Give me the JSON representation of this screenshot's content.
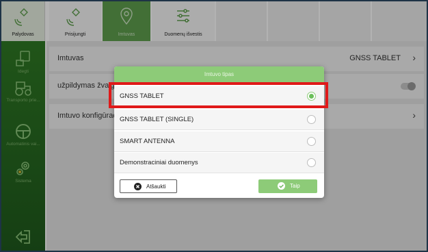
{
  "top_tabs": [
    {
      "label": "Palydovas",
      "icon": "satellite-icon"
    },
    {
      "label": "Prisijungti",
      "icon": "satellite-connect-icon"
    },
    {
      "label": "Imtuvas",
      "icon": "map-pin-icon"
    },
    {
      "label": "Duomenų išvestis",
      "icon": "sliders-icon"
    }
  ],
  "sidebar": {
    "items": [
      {
        "label": "Idegti",
        "icon": "monitor-icon"
      },
      {
        "label": "Transporto prie...",
        "icon": "tractor-icon"
      },
      {
        "label": "Automatinis vai...",
        "icon": "steering-wheel-icon"
      },
      {
        "label": "Sistema",
        "icon": "gears-icon"
      }
    ],
    "exit_icon": "exit-icon"
  },
  "main": {
    "rows": [
      {
        "label": "Imtuvas",
        "value": "GNSS TABLET"
      },
      {
        "label": "užpildymas žvaigž"
      },
      {
        "label": "Imtuvo konfigūracij"
      }
    ]
  },
  "dialog": {
    "title": "Imtuvo tipas",
    "options": [
      {
        "label": "GNSS TABLET",
        "selected": true
      },
      {
        "label": "GNSS TABLET (SINGLE)",
        "selected": false
      },
      {
        "label": "SMART ANTENNA",
        "selected": false
      },
      {
        "label": "Demonstraciniai duomenys",
        "selected": false
      }
    ],
    "cancel_label": "Atšaukti",
    "ok_label": "Taip"
  },
  "colors": {
    "accent": "#8dcb78",
    "sidebar": "#2f7a24",
    "highlight": "#e01919"
  }
}
